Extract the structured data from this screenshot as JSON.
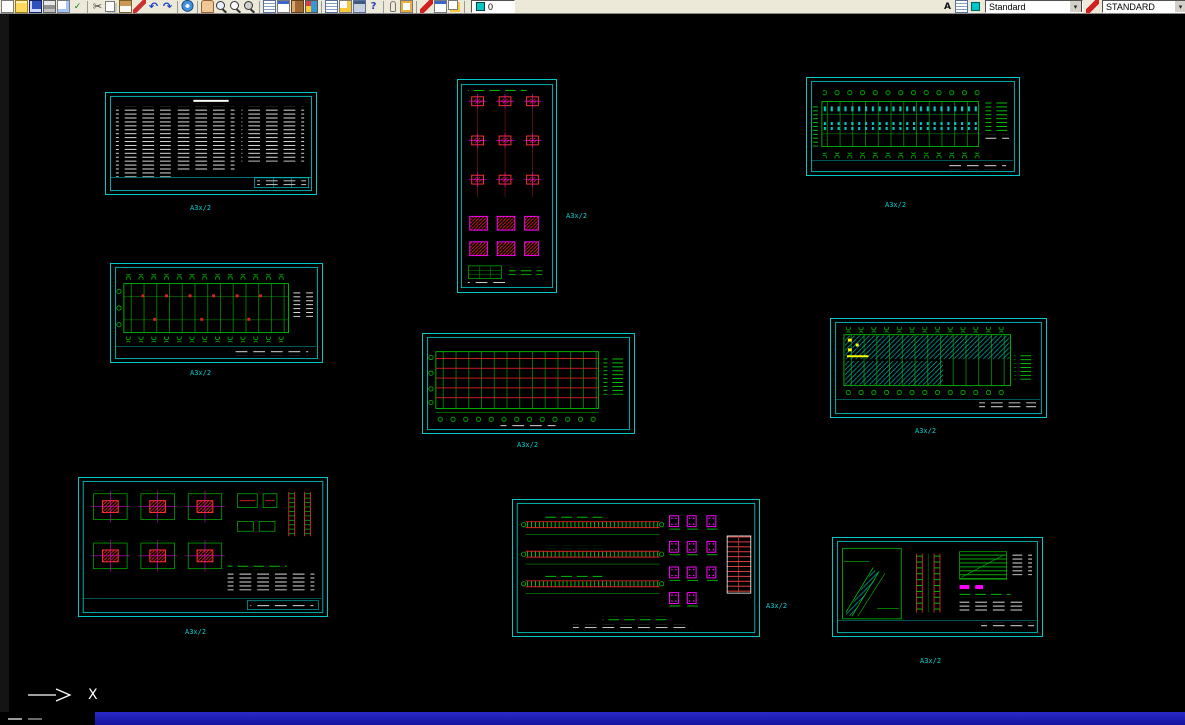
{
  "toolbar": {
    "layer_value": "0",
    "text_style": "Standard",
    "dim_style": "STANDARD",
    "arrow_glyph": "▾",
    "buttons": [
      {
        "name": "new-icon",
        "type": "page"
      },
      {
        "name": "open-icon",
        "type": "folder"
      },
      {
        "name": "save-icon",
        "type": "floppy"
      },
      {
        "name": "print-icon",
        "type": "printer"
      },
      {
        "name": "print-preview-icon",
        "type": "preview"
      },
      {
        "name": "spelling-icon",
        "type": "spell",
        "glyph": "✓"
      },
      {
        "type": "sep"
      },
      {
        "name": "cut-icon",
        "type": "cut",
        "glyph": "✂"
      },
      {
        "name": "copy-icon",
        "type": "copy"
      },
      {
        "name": "paste-icon",
        "type": "paste"
      },
      {
        "name": "match-properties-icon",
        "type": "brush"
      },
      {
        "name": "undo-icon",
        "type": "undo",
        "glyph": "↶"
      },
      {
        "name": "redo-icon",
        "type": "redo",
        "glyph": "↷"
      },
      {
        "type": "sep"
      },
      {
        "name": "insert-hyperlink-icon",
        "type": "link"
      },
      {
        "type": "sep"
      },
      {
        "name": "pan-realtime-icon",
        "type": "hand"
      },
      {
        "name": "zoom-realtime-icon",
        "type": "mag"
      },
      {
        "name": "zoom-window-icon",
        "type": "magwin"
      },
      {
        "name": "zoom-previous-icon",
        "type": "magprev"
      },
      {
        "type": "sep"
      },
      {
        "name": "named-views-icon",
        "type": "table"
      },
      {
        "name": "properties-icon",
        "type": "props"
      },
      {
        "name": "designcenter-icon",
        "type": "dcenter"
      },
      {
        "name": "tool-palettes-icon",
        "type": "palette"
      },
      {
        "type": "sep"
      },
      {
        "name": "sheet-set-manager-icon",
        "type": "table2"
      },
      {
        "name": "markup-set-manager-icon",
        "type": "docpen"
      },
      {
        "name": "quickcalc-icon",
        "type": "calc"
      },
      {
        "name": "help-icon",
        "type": "help",
        "glyph": "?"
      },
      {
        "type": "sep"
      },
      {
        "name": "attach-xref-icon",
        "type": "clip"
      },
      {
        "name": "field-icon",
        "type": "blocked"
      },
      {
        "type": "sep"
      },
      {
        "name": "make-block-icon",
        "type": "pencil"
      },
      {
        "name": "insert-block-icon",
        "type": "props"
      },
      {
        "name": "layer-properties-icon",
        "type": "layers"
      },
      {
        "type": "sep"
      }
    ],
    "right_buttons": [
      {
        "name": "text-style-manager-icon",
        "type": "styleA",
        "glyph": "A"
      },
      {
        "name": "named-views-right-icon",
        "type": "table"
      },
      {
        "name": "render-icon",
        "type": "colorsq"
      }
    ]
  },
  "sheets": [
    {
      "label": "A3x/2"
    },
    {
      "label": "A3x/2"
    },
    {
      "label": "A3x/2"
    },
    {
      "label": "A3x/2"
    },
    {
      "label": "A3x/2"
    },
    {
      "label": "A3x/2"
    },
    {
      "label": "A3x/2"
    },
    {
      "label": "A3x/2"
    },
    {
      "label": "A3x/2"
    }
  ],
  "ucs": {
    "axis_label": "X"
  },
  "colors": {
    "sheet_border": "#00c8c8",
    "line_green": "#00c000",
    "line_red": "#e02020",
    "line_magenta": "#ff00ff",
    "line_cyan": "#00c8c8",
    "line_white": "#ffffff",
    "line_yellow": "#ffff00",
    "taskbar_blue": "#1c1cb4"
  }
}
